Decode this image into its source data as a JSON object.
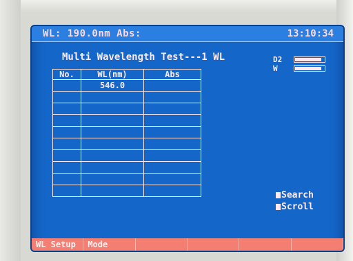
{
  "header": {
    "status": "WL: 190.0nm Abs:",
    "time": "13:10:34"
  },
  "test": {
    "title": "Multi Wavelength Test---1 WL"
  },
  "lamps": [
    {
      "label": "D2",
      "level": 0.9
    },
    {
      "label": "W",
      "level": 0.9
    }
  ],
  "table": {
    "columns": [
      "No.",
      "WL(nm)",
      "Abs"
    ],
    "rows": [
      [
        "",
        "546.0",
        ""
      ],
      [
        "",
        "",
        ""
      ],
      [
        "",
        "",
        ""
      ],
      [
        "",
        "",
        ""
      ],
      [
        "",
        "",
        ""
      ],
      [
        "",
        "",
        ""
      ],
      [
        "",
        "",
        ""
      ],
      [
        "",
        "",
        ""
      ],
      [
        "",
        "",
        ""
      ],
      [
        "",
        "",
        ""
      ]
    ]
  },
  "side_actions": {
    "search": "Search",
    "scroll": "Scroll"
  },
  "softkeys": [
    "WL Setup",
    "Mode",
    "",
    "",
    "",
    ""
  ],
  "colors": {
    "screen": "#1466c8",
    "text": "#ffe9ef",
    "softkey_bar": "#f27f72"
  }
}
